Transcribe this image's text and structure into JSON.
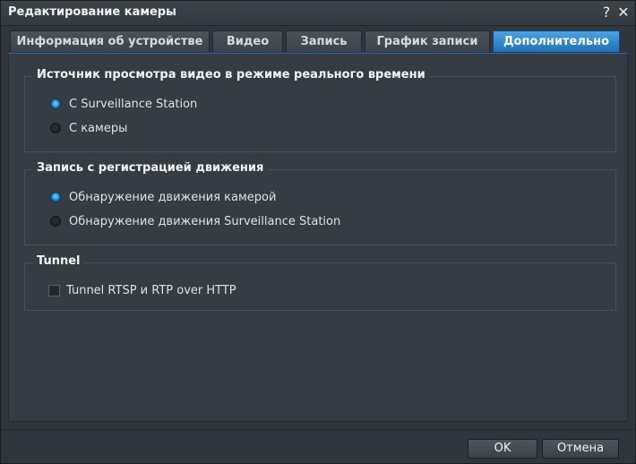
{
  "window": {
    "title": "Редактирование камеры",
    "help_label": "?",
    "close_label": "✕"
  },
  "tabs": [
    {
      "label": "Информация об устройстве",
      "active": false
    },
    {
      "label": "Видео",
      "active": false
    },
    {
      "label": "Запись",
      "active": false
    },
    {
      "label": "График записи",
      "active": false
    },
    {
      "label": "Дополнительно",
      "active": true
    }
  ],
  "groups": {
    "live_view": {
      "title": "Источник просмотра видео в режиме реального времени",
      "options": [
        {
          "label": "С Surveillance Station",
          "selected": true
        },
        {
          "label": "С камеры",
          "selected": false
        }
      ]
    },
    "motion": {
      "title": "Запись с регистрацией движения",
      "options": [
        {
          "label": "Обнаружение движения камерой",
          "selected": true
        },
        {
          "label": "Обнаружение движения Surveillance Station",
          "selected": false
        }
      ]
    },
    "tunnel": {
      "title": "Tunnel",
      "checkbox_label": "Tunnel RTSP и RTP over HTTP",
      "checked": false
    }
  },
  "footer": {
    "ok_label": "OK",
    "cancel_label": "Отмена"
  },
  "colors": {
    "accent": "#1f6fb5",
    "background": "#30363d"
  }
}
